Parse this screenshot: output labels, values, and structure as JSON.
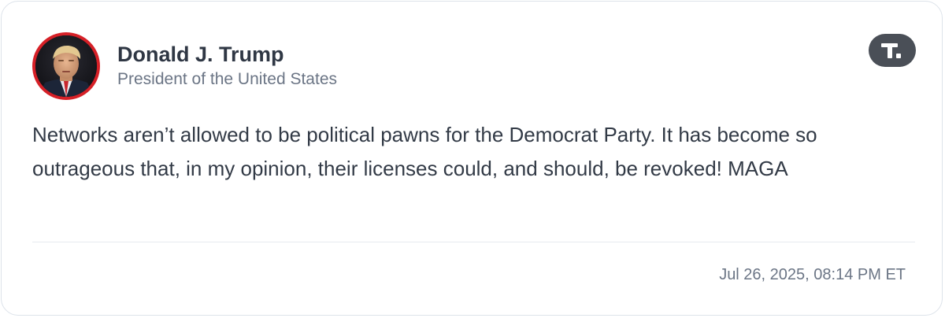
{
  "post": {
    "author_name": "Donald J. Trump",
    "author_title": "President of the United States",
    "text": "Networks aren’t allowed to be political pawns for the Democrat Party. It has become so outrageous that, in my opinion, their licenses could, and should, be revoked! MAGA",
    "timestamp": "Jul 26, 2025, 08:14 PM ET"
  },
  "icons": {
    "avatar": "profile-photo",
    "logo": "truth-social-logo-icon"
  },
  "colors": {
    "avatar_ring": "#d62027",
    "logo_bg": "#4a4f57",
    "name_text": "#2f3744",
    "secondary_text": "#6b7585",
    "body_text": "#323a46",
    "border": "#dde3ea"
  }
}
